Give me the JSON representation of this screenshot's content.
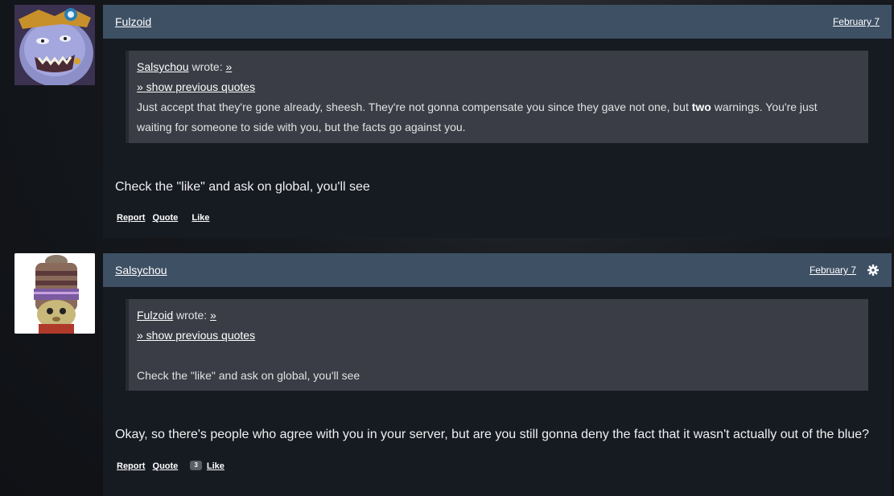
{
  "posts": [
    {
      "author": "Fulzoid",
      "date": "February 7",
      "quote": {
        "author": "Salsychou",
        "wrote": "wrote:",
        "jump": "»",
        "show_previous": "» show previous quotes",
        "text_before": "Just accept that they're gone already, sheesh. They're not gonna compensate you since they gave not one, but ",
        "text_bold": "two",
        "text_after": " warnings. You're just",
        "text_line2": "waiting for someone to side with you, but the facts go against you."
      },
      "body": "Check the \"like\" and ask on global, you'll see",
      "actions": {
        "report": "Report",
        "quote": "Quote",
        "like": "Like"
      }
    },
    {
      "author": "Salsychou",
      "date": "February 7",
      "quote": {
        "author": "Fulzoid",
        "wrote": "wrote:",
        "jump": "»",
        "show_previous": "» show previous quotes",
        "text": "Check the \"like\" and ask on global, you'll see"
      },
      "body": "Okay, so there's people who agree with you in your server, but are you still gonna deny the fact that it wasn't actually out of the blue?",
      "actions": {
        "report": "Report",
        "quote": "Quote",
        "like_count": "3",
        "like": "Like"
      }
    }
  ],
  "icons": {
    "settings": "gear-icon"
  },
  "colors": {
    "header_bg": "#3e5064",
    "quote_bg": "#3a3d45",
    "card_bg": "#161a21"
  }
}
